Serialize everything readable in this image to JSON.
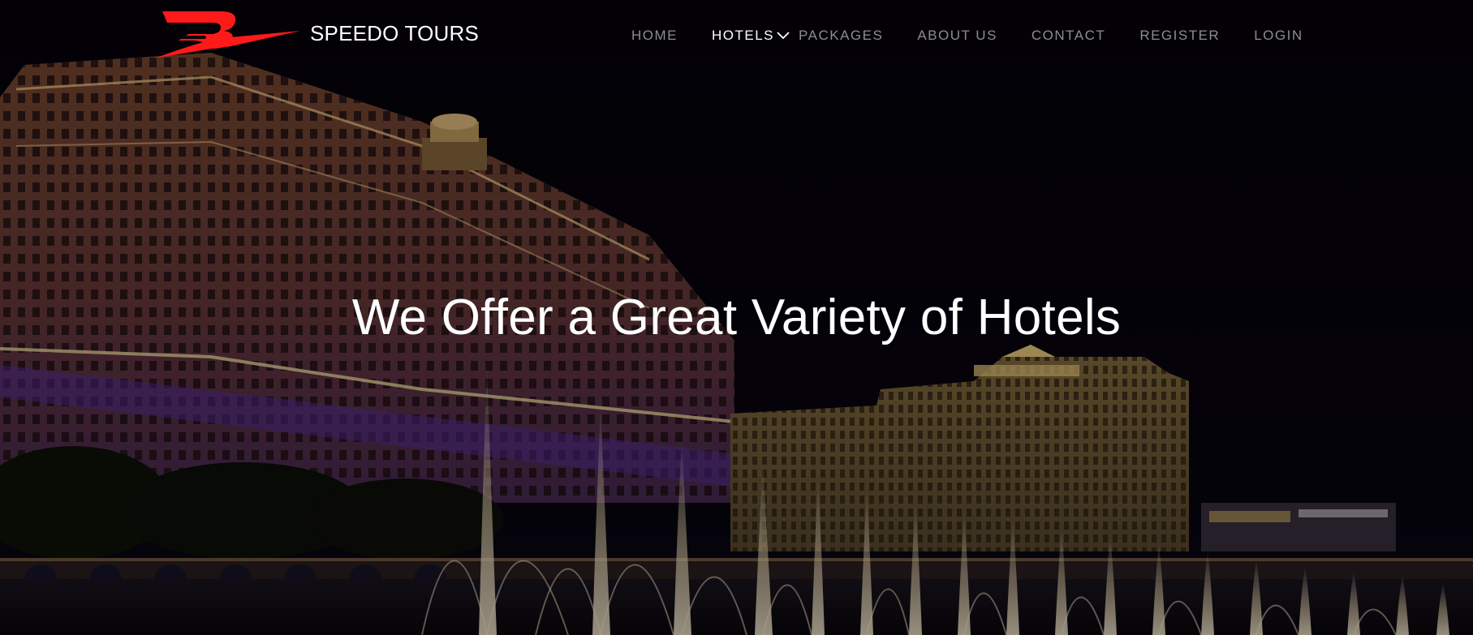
{
  "brand": {
    "name": "SPEEDO TOURS",
    "logo_icon": "speedo-logo",
    "logo_color": "#ff1a1a"
  },
  "nav": {
    "items": [
      {
        "label": "HOME",
        "active": false
      },
      {
        "label": "HOTELS",
        "active": true,
        "dropdown": true
      },
      {
        "label": "PACKAGES",
        "active": false
      },
      {
        "label": "ABOUT US",
        "active": false
      },
      {
        "label": "CONTACT",
        "active": false
      },
      {
        "label": "REGISTER",
        "active": false
      },
      {
        "label": "LOGIN",
        "active": false
      }
    ],
    "active_color": "#ffffff",
    "inactive_color": "#8d8d8d"
  },
  "hero": {
    "headline": "We Offer a Great Variety of Hotels",
    "background_image": "night-hotel-fountains"
  }
}
